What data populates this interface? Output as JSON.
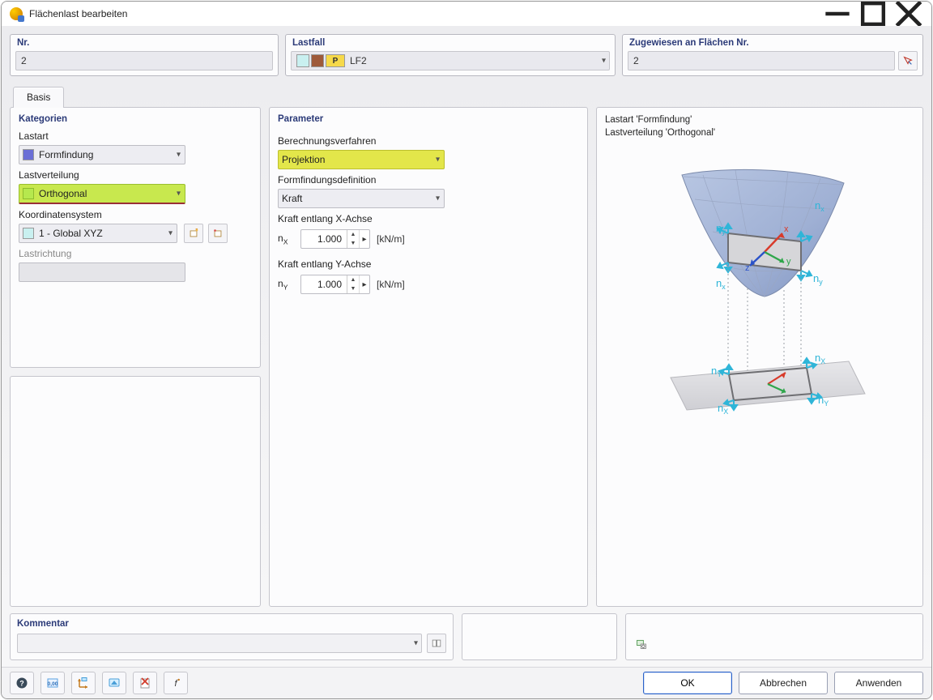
{
  "window": {
    "title": "Flächenlast bearbeiten"
  },
  "top": {
    "nr_label": "Nr.",
    "nr_value": "2",
    "lf_label": "Lastfall",
    "lf_badge": "P",
    "lf_value": "LF2",
    "zw_label": "Zugewiesen an Flächen Nr.",
    "zw_value": "2"
  },
  "tabs": {
    "basis": "Basis"
  },
  "categories": {
    "title": "Kategorien",
    "lastart_label": "Lastart",
    "lastart_value": "Formfindung",
    "lastverteilung_label": "Lastverteilung",
    "lastverteilung_value": "Orthogonal",
    "koord_label": "Koordinatensystem",
    "koord_value": "1 - Global XYZ",
    "lastrichtung_label": "Lastrichtung"
  },
  "parameters": {
    "title": "Parameter",
    "calc_label": "Berechnungsverfahren",
    "calc_value": "Projektion",
    "ffdef_label": "Formfindungsdefinition",
    "ffdef_value": "Kraft",
    "force_x_label": "Kraft entlang X-Achse",
    "force_x_sym": "n",
    "force_x_sub": "X",
    "force_x_value": "1.000",
    "force_x_unit": "[kN/m]",
    "force_y_label": "Kraft entlang Y-Achse",
    "force_y_sym": "n",
    "force_y_sub": "Y",
    "force_y_value": "1.000",
    "force_y_unit": "[kN/m]"
  },
  "preview": {
    "line1": "Lastart 'Formfindung'",
    "line2": "Lastverteilung 'Orthogonal'"
  },
  "comment": {
    "label": "Kommentar"
  },
  "footer": {
    "ok": "OK",
    "cancel": "Abbrechen",
    "apply": "Anwenden"
  }
}
